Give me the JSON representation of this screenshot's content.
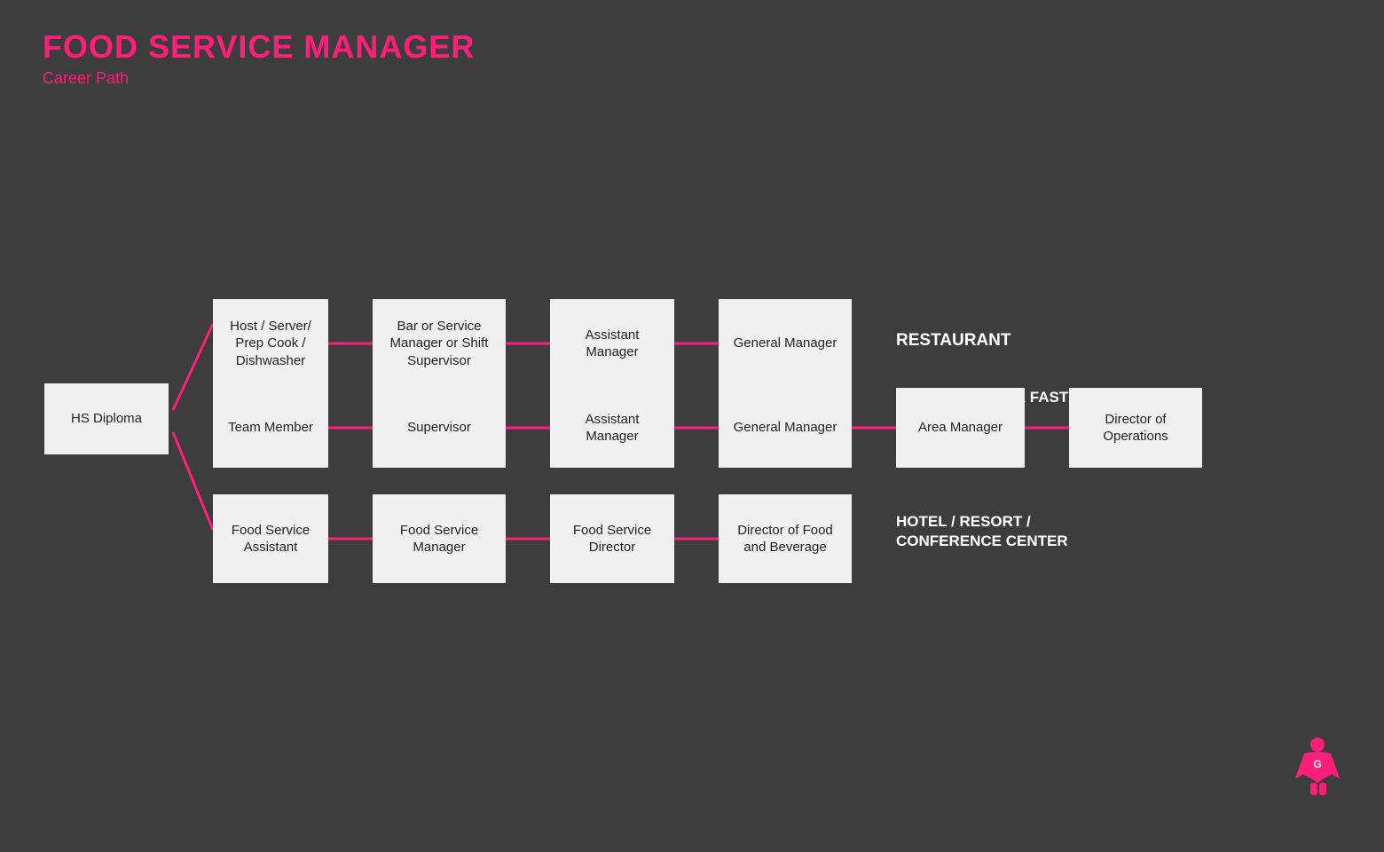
{
  "header": {
    "title": "Food Service Manager",
    "subtitle": "Career Path"
  },
  "colors": {
    "pink": "#ff1f7a",
    "box_bg": "#f0f0f0",
    "bg": "#3d3d3d",
    "text_dark": "#222222",
    "text_white": "#ffffff"
  },
  "boxes": {
    "hs_diploma": "HS Diploma",
    "host_server": "Host / Server/ Prep Cook / Dishwasher",
    "bar_service": "Bar or Service Manager or Shift Supervisor",
    "assistant_manager_top": "Assistant Manager",
    "general_manager_top": "General Manager",
    "team_member": "Team Member",
    "supervisor": "Supervisor",
    "assistant_manager_mid": "Assistant Manager",
    "general_manager_mid": "General Manager",
    "area_manager": "Area Manager",
    "director_operations": "Director of Operations",
    "food_service_assistant": "Food Service Assistant",
    "food_service_manager": "Food Service Manager",
    "food_service_director": "Food Service Director",
    "director_food_beverage": "Director of Food and Beverage"
  },
  "labels": {
    "restaurant": "RESTAURANT",
    "restaurant_chain": "RESTAURANT OR FAST CASUAL CHAIN",
    "hotel": "HOTEL / RESORT / CONFERENCE CENTER"
  },
  "logo_letter": "G"
}
